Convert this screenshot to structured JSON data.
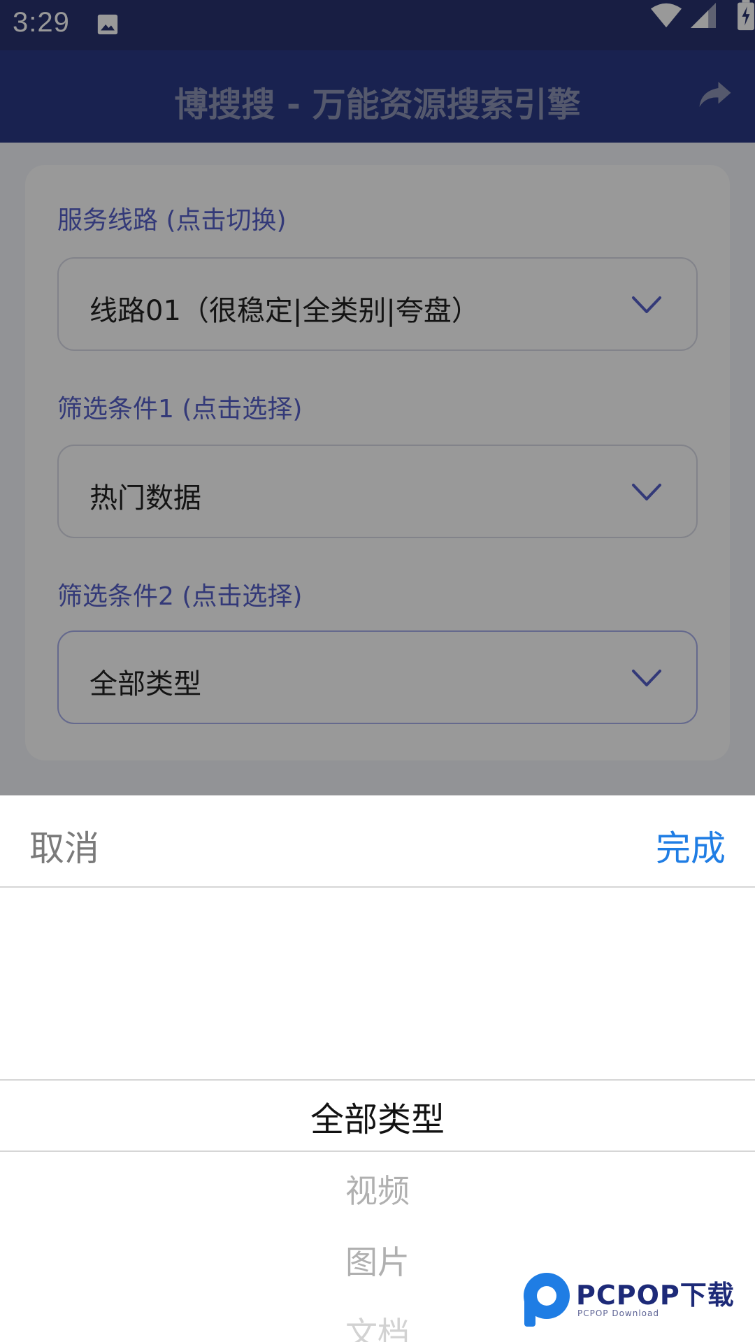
{
  "status_bar": {
    "time": "3:29",
    "icons": [
      "image-icon",
      "wifi-icon",
      "signal-icon",
      "battery-charging-icon"
    ]
  },
  "app_bar": {
    "title": "博搜搜 - 万能资源搜索引擎",
    "share_icon": "share-icon"
  },
  "form": {
    "route": {
      "label": "服务线路 (点击切换)",
      "value": "线路01（很稳定|全类别|夸盘）"
    },
    "filter1": {
      "label": "筛选条件1 (点击选择)",
      "value": "热门数据"
    },
    "filter2": {
      "label": "筛选条件2 (点击选择)",
      "value": "全部类型"
    }
  },
  "picker": {
    "cancel_label": "取消",
    "done_label": "完成",
    "items": [
      "全部类型",
      "视频",
      "图片",
      "文档"
    ],
    "selected_index": 0
  },
  "watermark": {
    "text": "PCPOP下载",
    "sub": "PCPOP Download"
  },
  "colors": {
    "status_bar": "#283370",
    "app_bar": "#2b3a85",
    "accent": "#5560c9",
    "done_blue": "#1f7de4"
  }
}
